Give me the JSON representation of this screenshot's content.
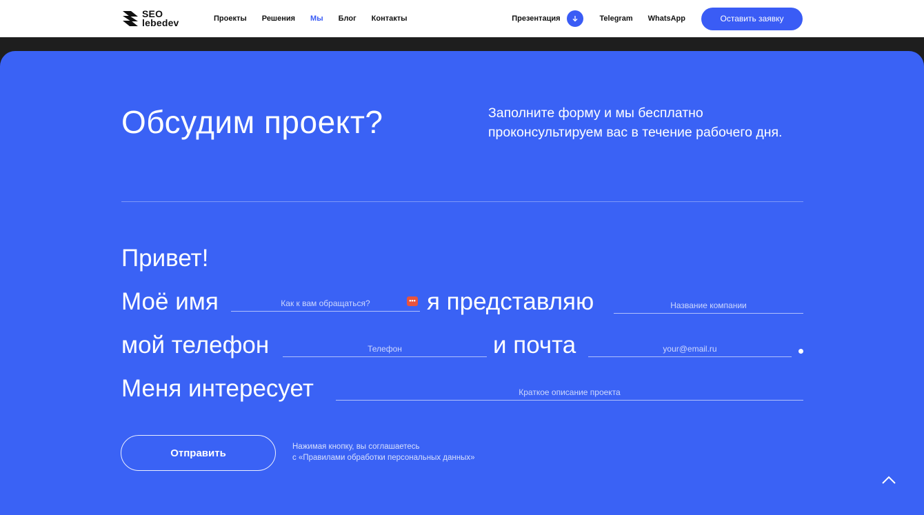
{
  "header": {
    "logo": {
      "line1": "SEO",
      "line2": "lebedev"
    },
    "nav": [
      "Проекты",
      "Решения",
      "Мы",
      "Блог",
      "Контакты"
    ],
    "active_nav": "Мы",
    "presentation_label": "Презентация",
    "telegram_label": "Telegram",
    "whatsapp_label": "WhatsApp",
    "cta_label": "Оставить заявку"
  },
  "hero": {
    "title": "Обсудим проект?",
    "lead": "Заполните форму и мы бесплатно проконсультируем вас в течение рабочего дня."
  },
  "form": {
    "greeting": "Привет!",
    "name_prefix": "Моё имя",
    "name_placeholder": "Как к вам обращаться?",
    "company_prefix": "я представляю",
    "company_placeholder": "Название компании",
    "phone_prefix": "мой телефон",
    "phone_placeholder": "Телефон",
    "email_prefix": "и почта",
    "email_placeholder": "your@email.ru",
    "interest_prefix": "Меня интересует",
    "description_placeholder": "Краткое описание проекта",
    "submit_label": "Отправить",
    "consent_line1": "Нажимая кнопку, вы соглашаетесь",
    "consent_line2": "с «Правилами обработки персональных данных»"
  },
  "colors": {
    "accent": "#3a5cf5",
    "panel": "#3a62f5",
    "header_bg": "#ffffff",
    "page_bg": "#1e1e1e"
  },
  "icons": {
    "logo": "logo-stripes-icon",
    "presentation": "arrow-down-icon",
    "autofill": "password-manager-key-icon",
    "scroll_top": "chevron-up-icon"
  }
}
